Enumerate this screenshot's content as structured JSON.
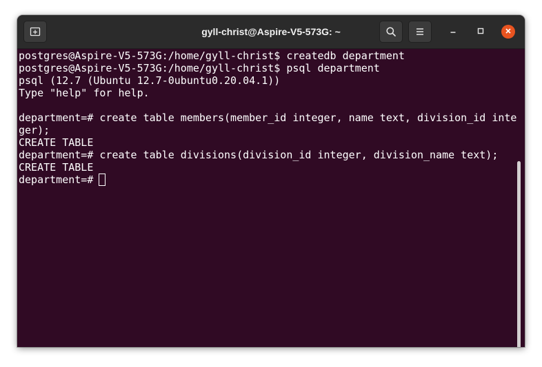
{
  "window": {
    "title": "gyll-christ@Aspire-V5-573G: ~"
  },
  "titlebar": {
    "new_tab_icon": "new-tab-icon",
    "search_icon": "search-icon",
    "menu_icon": "hamburger-menu-icon",
    "minimize_icon": "minimize-icon",
    "maximize_icon": "maximize-icon",
    "close_icon": "close-icon"
  },
  "colors": {
    "terminal_background": "#300a24",
    "titlebar_background": "#2b2b2b",
    "close_button": "#e95420",
    "text": "#ffffff"
  },
  "terminal": {
    "lines": [
      "postgres@Aspire-V5-573G:/home/gyll-christ$ createdb department",
      "postgres@Aspire-V5-573G:/home/gyll-christ$ psql department",
      "psql (12.7 (Ubuntu 12.7-0ubuntu0.20.04.1))",
      "Type \"help\" for help.",
      "",
      "department=# create table members(member_id integer, name text, division_id inte",
      "ger);",
      "CREATE TABLE",
      "department=# create table divisions(division_id integer, division_name text);",
      "CREATE TABLE",
      "department=# "
    ]
  }
}
